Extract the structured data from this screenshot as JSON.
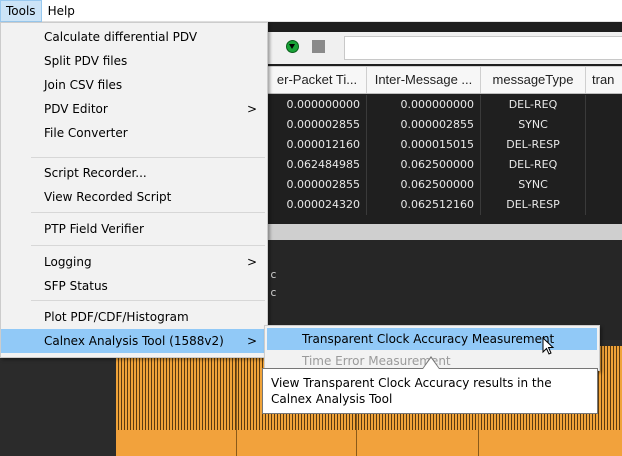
{
  "menubar": {
    "items": [
      "Tools",
      "Help"
    ]
  },
  "table": {
    "headers": [
      "er-Packet Ti...",
      "Inter-Message ...",
      "messageType",
      "tran"
    ],
    "rows": [
      [
        "0.000000000",
        "0.000000000",
        "DEL-REQ"
      ],
      [
        "0.000002855",
        "0.000002855",
        "SYNC"
      ],
      [
        "0.000012160",
        "0.000015015",
        "DEL-RESP"
      ],
      [
        "0.062484985",
        "0.062500000",
        "DEL-REQ"
      ],
      [
        "0.000002855",
        "0.062500000",
        "SYNC"
      ],
      [
        "0.000024320",
        "0.062512160",
        "DEL-RESP"
      ]
    ]
  },
  "darkarea": {
    "labels": [
      "c",
      "c"
    ]
  },
  "tools_menu": {
    "items": [
      "Calculate differential PDV",
      "Split PDV files",
      "Join CSV files",
      "PDV Editor",
      "File Converter",
      "Script Recorder...",
      "View Recorded Script",
      "PTP Field Verifier",
      "Logging",
      "SFP Status",
      "Plot PDF/CDF/Histogram",
      "Calnex Analysis Tool (1588v2)"
    ],
    "arrow": ">"
  },
  "submenu": {
    "items": [
      "Transparent Clock Accuracy Measurement",
      "Time Error Measurement"
    ]
  },
  "tooltip": {
    "text": "View Transparent Clock Accuracy results in the Calnex Analysis Tool"
  },
  "colors": {
    "highlight": "#91c9f7",
    "menu_bg": "#f2f2f2",
    "bars": "#f0a339"
  }
}
